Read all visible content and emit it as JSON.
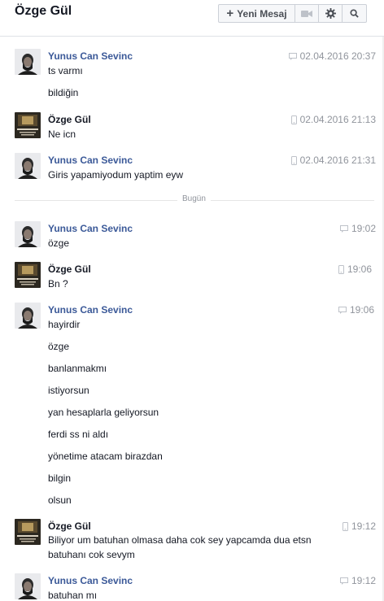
{
  "header": {
    "title": "Özge Gül",
    "new_message_label": "Yeni Mesaj"
  },
  "divider": {
    "label": "Bugün"
  },
  "messages": [
    {
      "sender": "Yunus Can Sevinc",
      "time": "02.04.2016 20:37",
      "lines": [
        "ts varmı",
        "bildiğin"
      ]
    },
    {
      "sender": "Özge Gül",
      "time": "02.04.2016 21:13",
      "lines": [
        "Ne icn"
      ]
    },
    {
      "sender": "Yunus Can Sevinc",
      "time": "02.04.2016 21:31",
      "lines": [
        "Giris yapamiyodum yaptim eyw"
      ]
    },
    {
      "sender": "Yunus Can Sevinc",
      "time": "19:02",
      "lines": [
        "özge"
      ]
    },
    {
      "sender": "Özge Gül",
      "time": "19:06",
      "lines": [
        "Bn ?"
      ]
    },
    {
      "sender": "Yunus Can Sevinc",
      "time": "19:06",
      "lines": [
        "hayirdir",
        "özge",
        "banlanmakmı",
        "istiyorsun",
        "yan hesaplarla geliyorsun",
        "ferdi ss ni aldı",
        "yönetime atacam birazdan",
        "bilgin",
        "olsun"
      ]
    },
    {
      "sender": "Özge Gül",
      "time": "19:12",
      "lines": [
        "Biliyor um batuhan olmasa daha cok sey yapcamda dua etsn batuhanı cok sevym"
      ]
    },
    {
      "sender": "Yunus Can Sevinc",
      "time": "19:12",
      "lines": [
        "batuhan mı"
      ]
    }
  ]
}
